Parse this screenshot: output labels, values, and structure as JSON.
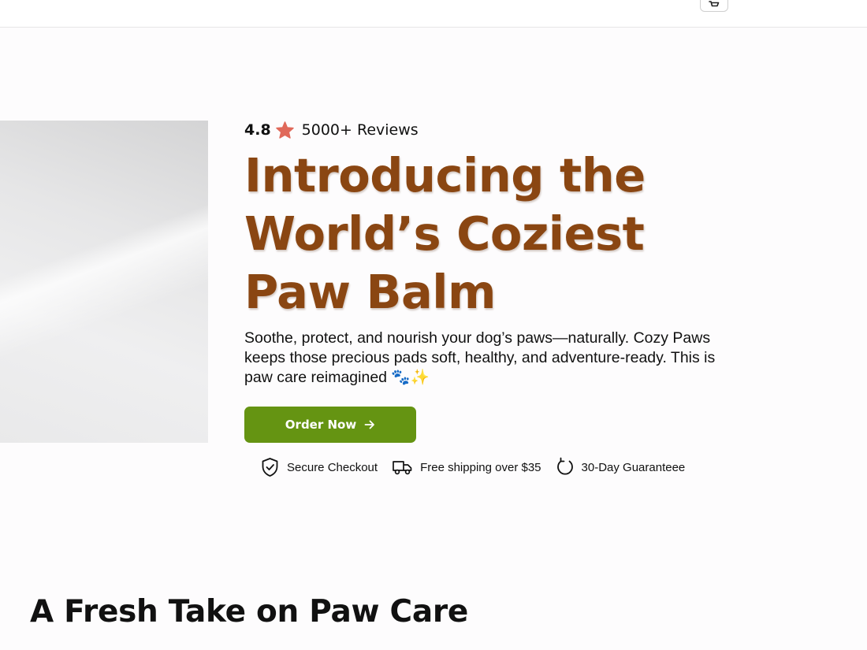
{
  "header": {
    "cart_icon": "cart-icon"
  },
  "hero": {
    "rating_score": "4.8",
    "rating_icon": "star-icon",
    "rating_color": "#e0695a",
    "reviews_text": "5000+ Reviews",
    "title": "Introducing the World’s Coziest Paw Balm",
    "title_color": "#8a4612",
    "description": "Soothe, protect, and nourish your dog’s paws—naturally. Cozy Paws keeps those precious pads soft, healthy, and adventure-ready. This is paw care reimagined 🐾✨",
    "cta": {
      "label": "Order Now",
      "icon": "arrow-right-icon",
      "color": "#659412"
    },
    "trust_badges": [
      {
        "icon": "shield-check-icon",
        "label": "Secure Checkout"
      },
      {
        "icon": "truck-icon",
        "label": "Free shipping over $35"
      },
      {
        "icon": "refresh-icon",
        "label": "30-Day Guaranteee"
      }
    ]
  },
  "section": {
    "title": "A Fresh Take on Paw Care"
  }
}
